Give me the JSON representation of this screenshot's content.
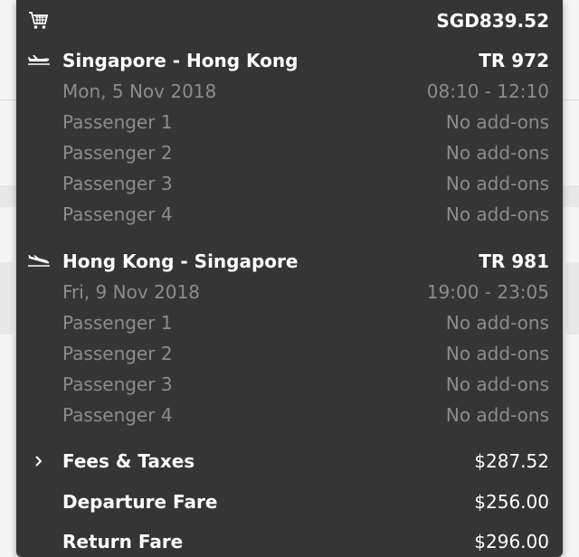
{
  "total": "SGD839.52",
  "icons": {
    "cart": "cart-icon",
    "plane": "plane-icon",
    "chevron": "chevron-right-icon"
  },
  "flights": [
    {
      "route": "Singapore - Hong Kong",
      "flight_no": "TR 972",
      "date": "Mon, 5 Nov 2018",
      "time": "08:10 - 12:10",
      "passengers": [
        {
          "name": "Passenger 1",
          "addons": "No add-ons"
        },
        {
          "name": "Passenger 2",
          "addons": "No add-ons"
        },
        {
          "name": "Passenger 3",
          "addons": "No add-ons"
        },
        {
          "name": "Passenger 4",
          "addons": "No add-ons"
        }
      ]
    },
    {
      "route": "Hong Kong - Singapore",
      "flight_no": "TR 981",
      "date": "Fri, 9 Nov 2018",
      "time": "19:00 - 23:05",
      "passengers": [
        {
          "name": "Passenger 1",
          "addons": "No add-ons"
        },
        {
          "name": "Passenger 2",
          "addons": "No add-ons"
        },
        {
          "name": "Passenger 3",
          "addons": "No add-ons"
        },
        {
          "name": "Passenger 4",
          "addons": "No add-ons"
        }
      ]
    }
  ],
  "summary": {
    "fees_label": "Fees & Taxes",
    "fees_value": "$287.52",
    "departure_label": "Departure Fare",
    "departure_value": "$256.00",
    "return_label": "Return Fare",
    "return_value": "$296.00"
  },
  "colors": {
    "panel_bg": "#353535",
    "primary_text": "#ffffff",
    "muted_text": "#8c8c8c"
  }
}
